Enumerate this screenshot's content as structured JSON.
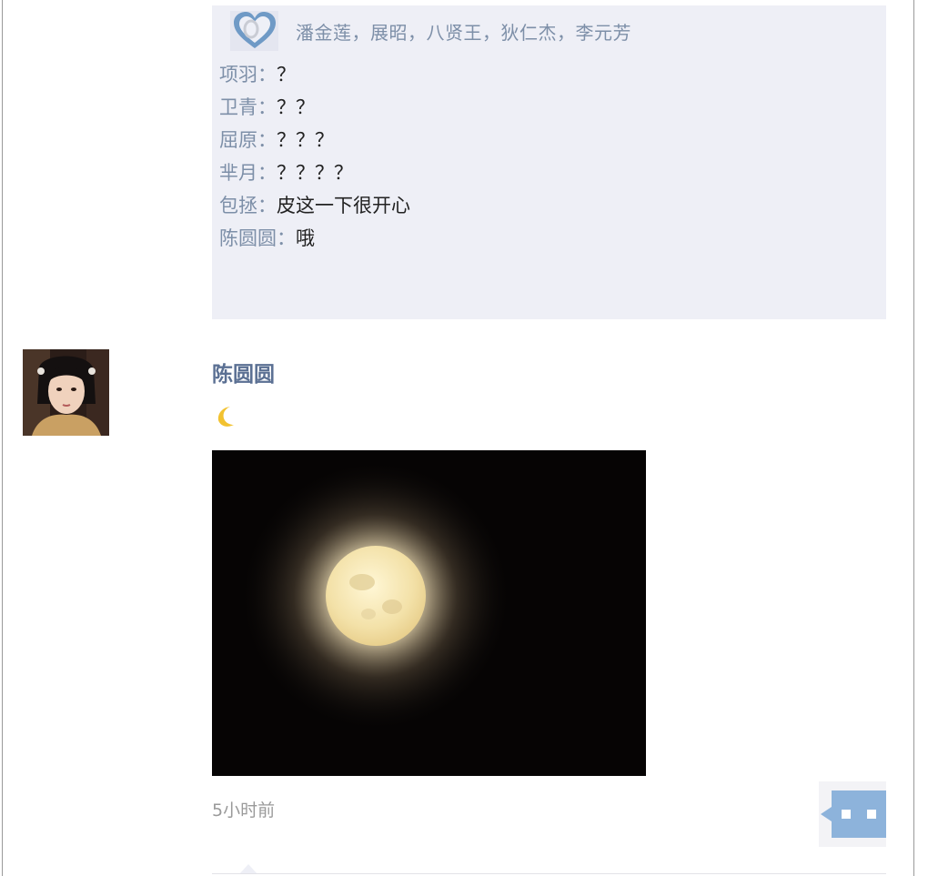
{
  "likes": {
    "icon": "heart-icon",
    "names": "潘金莲，展昭，八贤王，狄仁杰，李元芳"
  },
  "comments": [
    {
      "user": "项羽：",
      "text": "？"
    },
    {
      "user": "卫青：",
      "text": "？？"
    },
    {
      "user": "屈原：",
      "text": "？？？"
    },
    {
      "user": "芈月：",
      "text": "？？？？"
    },
    {
      "user": "包拯：",
      "text": "皮这一下很开心"
    },
    {
      "user": "陈圆圆：",
      "text": "哦"
    }
  ],
  "post": {
    "author": "陈圆圆",
    "emoji": "crescent-moon-icon",
    "image": "full-moon-photo",
    "time": "5小时前",
    "comment_button_icon": "comment-bubble-icon"
  },
  "colors": {
    "panel_bg": "#eeeff6",
    "name_link": "#7d8fa8",
    "author": "#5b7093",
    "comment_button": "#8db3db"
  }
}
